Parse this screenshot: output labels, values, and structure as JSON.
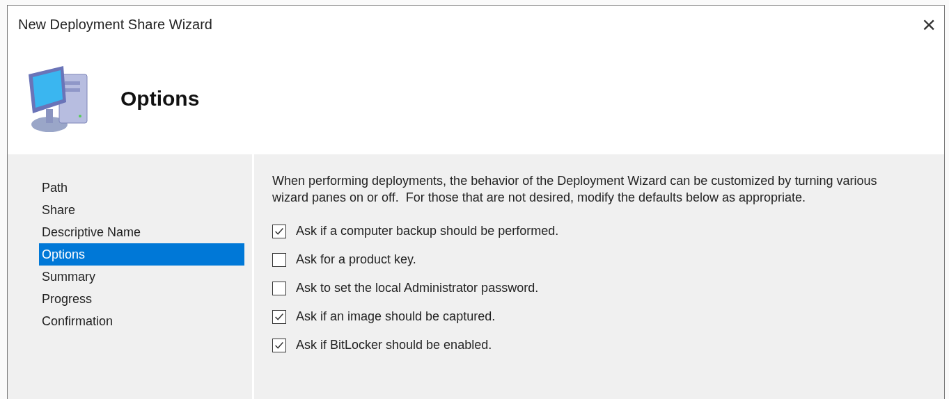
{
  "window": {
    "title": "New Deployment Share Wizard",
    "close": "×"
  },
  "header": {
    "title": "Options"
  },
  "steps": [
    {
      "label": "Path",
      "selected": false
    },
    {
      "label": "Share",
      "selected": false
    },
    {
      "label": "Descriptive Name",
      "selected": false
    },
    {
      "label": "Options",
      "selected": true
    },
    {
      "label": "Summary",
      "selected": false
    },
    {
      "label": "Progress",
      "selected": false
    },
    {
      "label": "Confirmation",
      "selected": false
    }
  ],
  "description": "When performing deployments, the behavior of the Deployment Wizard can be customized by turning various wizard panes on or off.  For those that are not desired, modify the defaults below as appropriate.",
  "options": [
    {
      "label": "Ask if a computer backup should be performed.",
      "checked": true
    },
    {
      "label": "Ask for a product key.",
      "checked": false
    },
    {
      "label": "Ask to set the local Administrator password.",
      "checked": false
    },
    {
      "label": "Ask if an image should be captured.",
      "checked": true
    },
    {
      "label": "Ask if BitLocker should be enabled.",
      "checked": true
    }
  ]
}
